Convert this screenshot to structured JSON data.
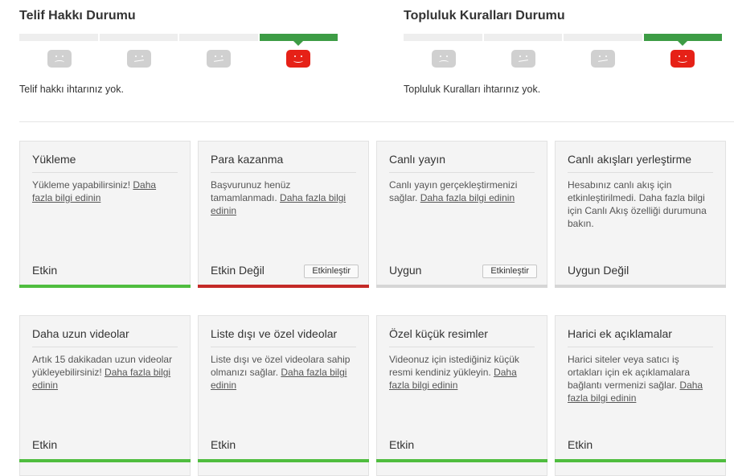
{
  "copyright": {
    "title": "Telif Hakkı Durumu",
    "text": "Telif hakkı ihtarınız yok.",
    "faces": [
      "sad-face-icon",
      "neutral-face-icon",
      "neutral-face-icon",
      "smile-face-icon"
    ],
    "active_index": 3
  },
  "community": {
    "title": "Topluluk Kuralları Durumu",
    "text": "Topluluk Kuralları ihtarınız yok.",
    "faces": [
      "sad-face-icon",
      "neutral-face-icon",
      "neutral-face-icon",
      "smile-face-icon"
    ],
    "active_index": 3
  },
  "colors": {
    "good": "#3d9c45",
    "strike_active": "#e62117",
    "enabled": "#4fbd3f",
    "disabled": "#c42a27"
  },
  "features": [
    {
      "title": "Yükleme",
      "text": "Yükleme yapabilirsiniz! ",
      "link": "Daha fazla bilgi edinin",
      "status": "Etkin",
      "button": "",
      "state": "green"
    },
    {
      "title": "Para kazanma",
      "text": "Başvurunuz henüz tamamlanmadı. ",
      "link": "Daha fazla bilgi edinin",
      "status": "Etkin Değil",
      "button": "Etkinleştir",
      "state": "red"
    },
    {
      "title": "Canlı yayın",
      "text": "Canlı yayın gerçekleştirmenizi sağlar. ",
      "link": "Daha fazla bilgi edinin",
      "status": "Uygun",
      "button": "Etkinleştir",
      "state": "gray"
    },
    {
      "title": "Canlı akışları yerleştirme",
      "text": "Hesabınız canlı akış için etkinleştirilmedi. Daha fazla bilgi için Canlı Akış özelliği durumuna bakın.",
      "link": "",
      "status": "Uygun Değil",
      "button": "",
      "state": "gray"
    },
    {
      "title": "Daha uzun videolar",
      "text": "Artık 15 dakikadan uzun videolar yükleyebilirsiniz! ",
      "link": "Daha fazla bilgi edinin",
      "status": "Etkin",
      "button": "",
      "state": "green"
    },
    {
      "title": "Liste dışı ve özel videolar",
      "text": "Liste dışı ve özel videolara sahip olmanızı sağlar. ",
      "link": "Daha fazla bilgi edinin",
      "status": "Etkin",
      "button": "",
      "state": "green"
    },
    {
      "title": "Özel küçük resimler",
      "text": "Videonuz için istediğiniz küçük resmi kendiniz yükleyin. ",
      "link": "Daha fazla bilgi edinin",
      "status": "Etkin",
      "button": "",
      "state": "green"
    },
    {
      "title": "Harici ek açıklamalar",
      "text": "Harici siteler veya satıcı iş ortakları için ek açıklamalara bağlantı vermenizi sağlar. ",
      "link": "Daha fazla bilgi edinin",
      "status": "Etkin",
      "button": "",
      "state": "green"
    }
  ]
}
